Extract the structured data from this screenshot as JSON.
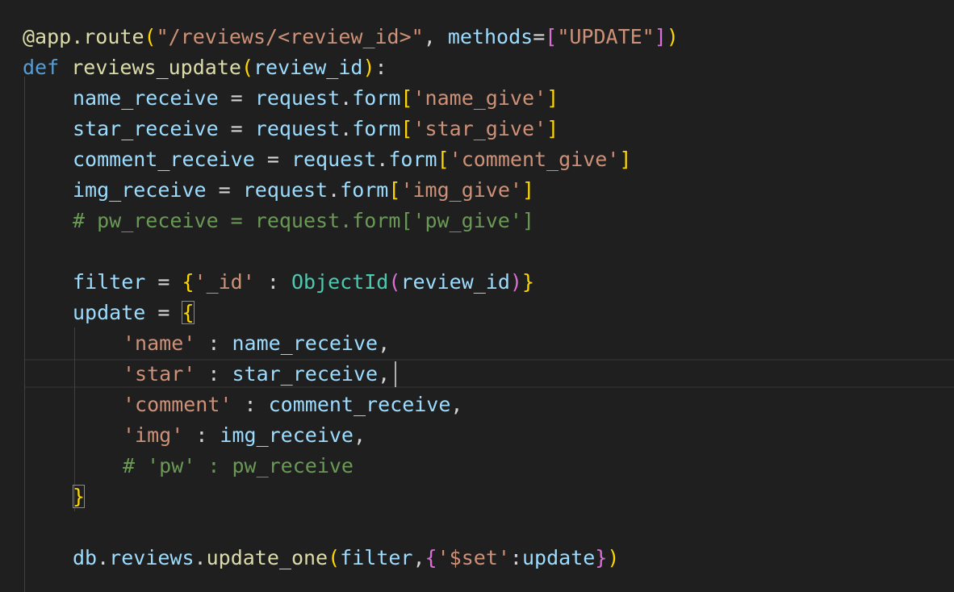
{
  "editor": {
    "language": "python",
    "theme_colors": {
      "background": "#1f1f1f",
      "keyword": "#569cd6",
      "function": "#dcdcaa",
      "variable": "#9cdcfe",
      "string": "#ce9178",
      "class": "#4ec9b0",
      "comment": "#6a9955",
      "bracket_level_1": "#ffd700",
      "bracket_level_2": "#da70d6",
      "bracket_level_3": "#179fff"
    },
    "lines": [
      {
        "indent": 0,
        "tokens": [
          {
            "t": "@app.route",
            "c": "deco"
          },
          {
            "t": "(",
            "c": "b1"
          },
          {
            "t": "\"/reviews/<review_id>\"",
            "c": "str"
          },
          {
            "t": ", ",
            "c": "pl"
          },
          {
            "t": "methods",
            "c": "var"
          },
          {
            "t": "=",
            "c": "pl"
          },
          {
            "t": "[",
            "c": "b2"
          },
          {
            "t": "\"UPDATE\"",
            "c": "str"
          },
          {
            "t": "]",
            "c": "b2"
          },
          {
            "t": ")",
            "c": "b1"
          }
        ]
      },
      {
        "indent": 0,
        "tokens": [
          {
            "t": "def",
            "c": "kw"
          },
          {
            "t": " ",
            "c": "pl"
          },
          {
            "t": "reviews_update",
            "c": "fn"
          },
          {
            "t": "(",
            "c": "b1"
          },
          {
            "t": "review_id",
            "c": "var"
          },
          {
            "t": ")",
            "c": "b1"
          },
          {
            "t": ":",
            "c": "pl"
          }
        ]
      },
      {
        "indent": 1,
        "tokens": [
          {
            "t": "name_receive",
            "c": "var"
          },
          {
            "t": " = ",
            "c": "pl"
          },
          {
            "t": "request",
            "c": "var"
          },
          {
            "t": ".",
            "c": "pl"
          },
          {
            "t": "form",
            "c": "var"
          },
          {
            "t": "[",
            "c": "b1"
          },
          {
            "t": "'name_give'",
            "c": "str"
          },
          {
            "t": "]",
            "c": "b1"
          }
        ]
      },
      {
        "indent": 1,
        "tokens": [
          {
            "t": "star_receive",
            "c": "var"
          },
          {
            "t": " = ",
            "c": "pl"
          },
          {
            "t": "request",
            "c": "var"
          },
          {
            "t": ".",
            "c": "pl"
          },
          {
            "t": "form",
            "c": "var"
          },
          {
            "t": "[",
            "c": "b1"
          },
          {
            "t": "'star_give'",
            "c": "str"
          },
          {
            "t": "]",
            "c": "b1"
          }
        ]
      },
      {
        "indent": 1,
        "tokens": [
          {
            "t": "comment_receive",
            "c": "var"
          },
          {
            "t": " = ",
            "c": "pl"
          },
          {
            "t": "request",
            "c": "var"
          },
          {
            "t": ".",
            "c": "pl"
          },
          {
            "t": "form",
            "c": "var"
          },
          {
            "t": "[",
            "c": "b1"
          },
          {
            "t": "'comment_give'",
            "c": "str"
          },
          {
            "t": "]",
            "c": "b1"
          }
        ]
      },
      {
        "indent": 1,
        "tokens": [
          {
            "t": "img_receive",
            "c": "var"
          },
          {
            "t": " = ",
            "c": "pl"
          },
          {
            "t": "request",
            "c": "var"
          },
          {
            "t": ".",
            "c": "pl"
          },
          {
            "t": "form",
            "c": "var"
          },
          {
            "t": "[",
            "c": "b1"
          },
          {
            "t": "'img_give'",
            "c": "str"
          },
          {
            "t": "]",
            "c": "b1"
          }
        ]
      },
      {
        "indent": 1,
        "tokens": [
          {
            "t": "# pw_receive = request.form['pw_give']",
            "c": "cmt"
          }
        ]
      },
      {
        "indent": 0,
        "tokens": []
      },
      {
        "indent": 1,
        "tokens": [
          {
            "t": "filter",
            "c": "var"
          },
          {
            "t": " = ",
            "c": "pl"
          },
          {
            "t": "{",
            "c": "b1"
          },
          {
            "t": "'_id'",
            "c": "str"
          },
          {
            "t": " : ",
            "c": "pl"
          },
          {
            "t": "ObjectId",
            "c": "cls"
          },
          {
            "t": "(",
            "c": "b2"
          },
          {
            "t": "review_id",
            "c": "var"
          },
          {
            "t": ")",
            "c": "b2"
          },
          {
            "t": "}",
            "c": "b1"
          }
        ]
      },
      {
        "indent": 1,
        "tokens": [
          {
            "t": "update",
            "c": "var"
          },
          {
            "t": " = ",
            "c": "pl"
          },
          {
            "t": "{",
            "c": "b1",
            "match": true
          }
        ]
      },
      {
        "indent": 2,
        "tokens": [
          {
            "t": "'name'",
            "c": "str"
          },
          {
            "t": " : ",
            "c": "pl"
          },
          {
            "t": "name_receive",
            "c": "var"
          },
          {
            "t": ",",
            "c": "pl"
          }
        ]
      },
      {
        "indent": 2,
        "tokens": [
          {
            "t": "'star'",
            "c": "str"
          },
          {
            "t": " : ",
            "c": "pl"
          },
          {
            "t": "star_receive",
            "c": "var"
          },
          {
            "t": ",",
            "c": "pl"
          }
        ]
      },
      {
        "indent": 2,
        "tokens": [
          {
            "t": "'comment'",
            "c": "str"
          },
          {
            "t": " : ",
            "c": "pl"
          },
          {
            "t": "comment_receive",
            "c": "var"
          },
          {
            "t": ",",
            "c": "pl"
          }
        ]
      },
      {
        "indent": 2,
        "tokens": [
          {
            "t": "'img'",
            "c": "str"
          },
          {
            "t": " : ",
            "c": "pl"
          },
          {
            "t": "img_receive",
            "c": "var"
          },
          {
            "t": ",",
            "c": "pl"
          }
        ]
      },
      {
        "indent": 2,
        "tokens": [
          {
            "t": "# 'pw' : pw_receive",
            "c": "cmt"
          }
        ]
      },
      {
        "indent": 1,
        "tokens": [
          {
            "t": "}",
            "c": "b1",
            "match": true
          }
        ]
      },
      {
        "indent": 0,
        "tokens": []
      },
      {
        "indent": 1,
        "tokens": [
          {
            "t": "db",
            "c": "var"
          },
          {
            "t": ".",
            "c": "pl"
          },
          {
            "t": "reviews",
            "c": "var"
          },
          {
            "t": ".",
            "c": "pl"
          },
          {
            "t": "update_one",
            "c": "fn"
          },
          {
            "t": "(",
            "c": "b1"
          },
          {
            "t": "filter",
            "c": "var"
          },
          {
            "t": ",",
            "c": "pl"
          },
          {
            "t": "{",
            "c": "b2"
          },
          {
            "t": "'$set'",
            "c": "str"
          },
          {
            "t": ":",
            "c": "pl"
          },
          {
            "t": "update",
            "c": "var"
          },
          {
            "t": "}",
            "c": "b2"
          },
          {
            "t": ")",
            "c": "b1"
          }
        ]
      }
    ]
  }
}
